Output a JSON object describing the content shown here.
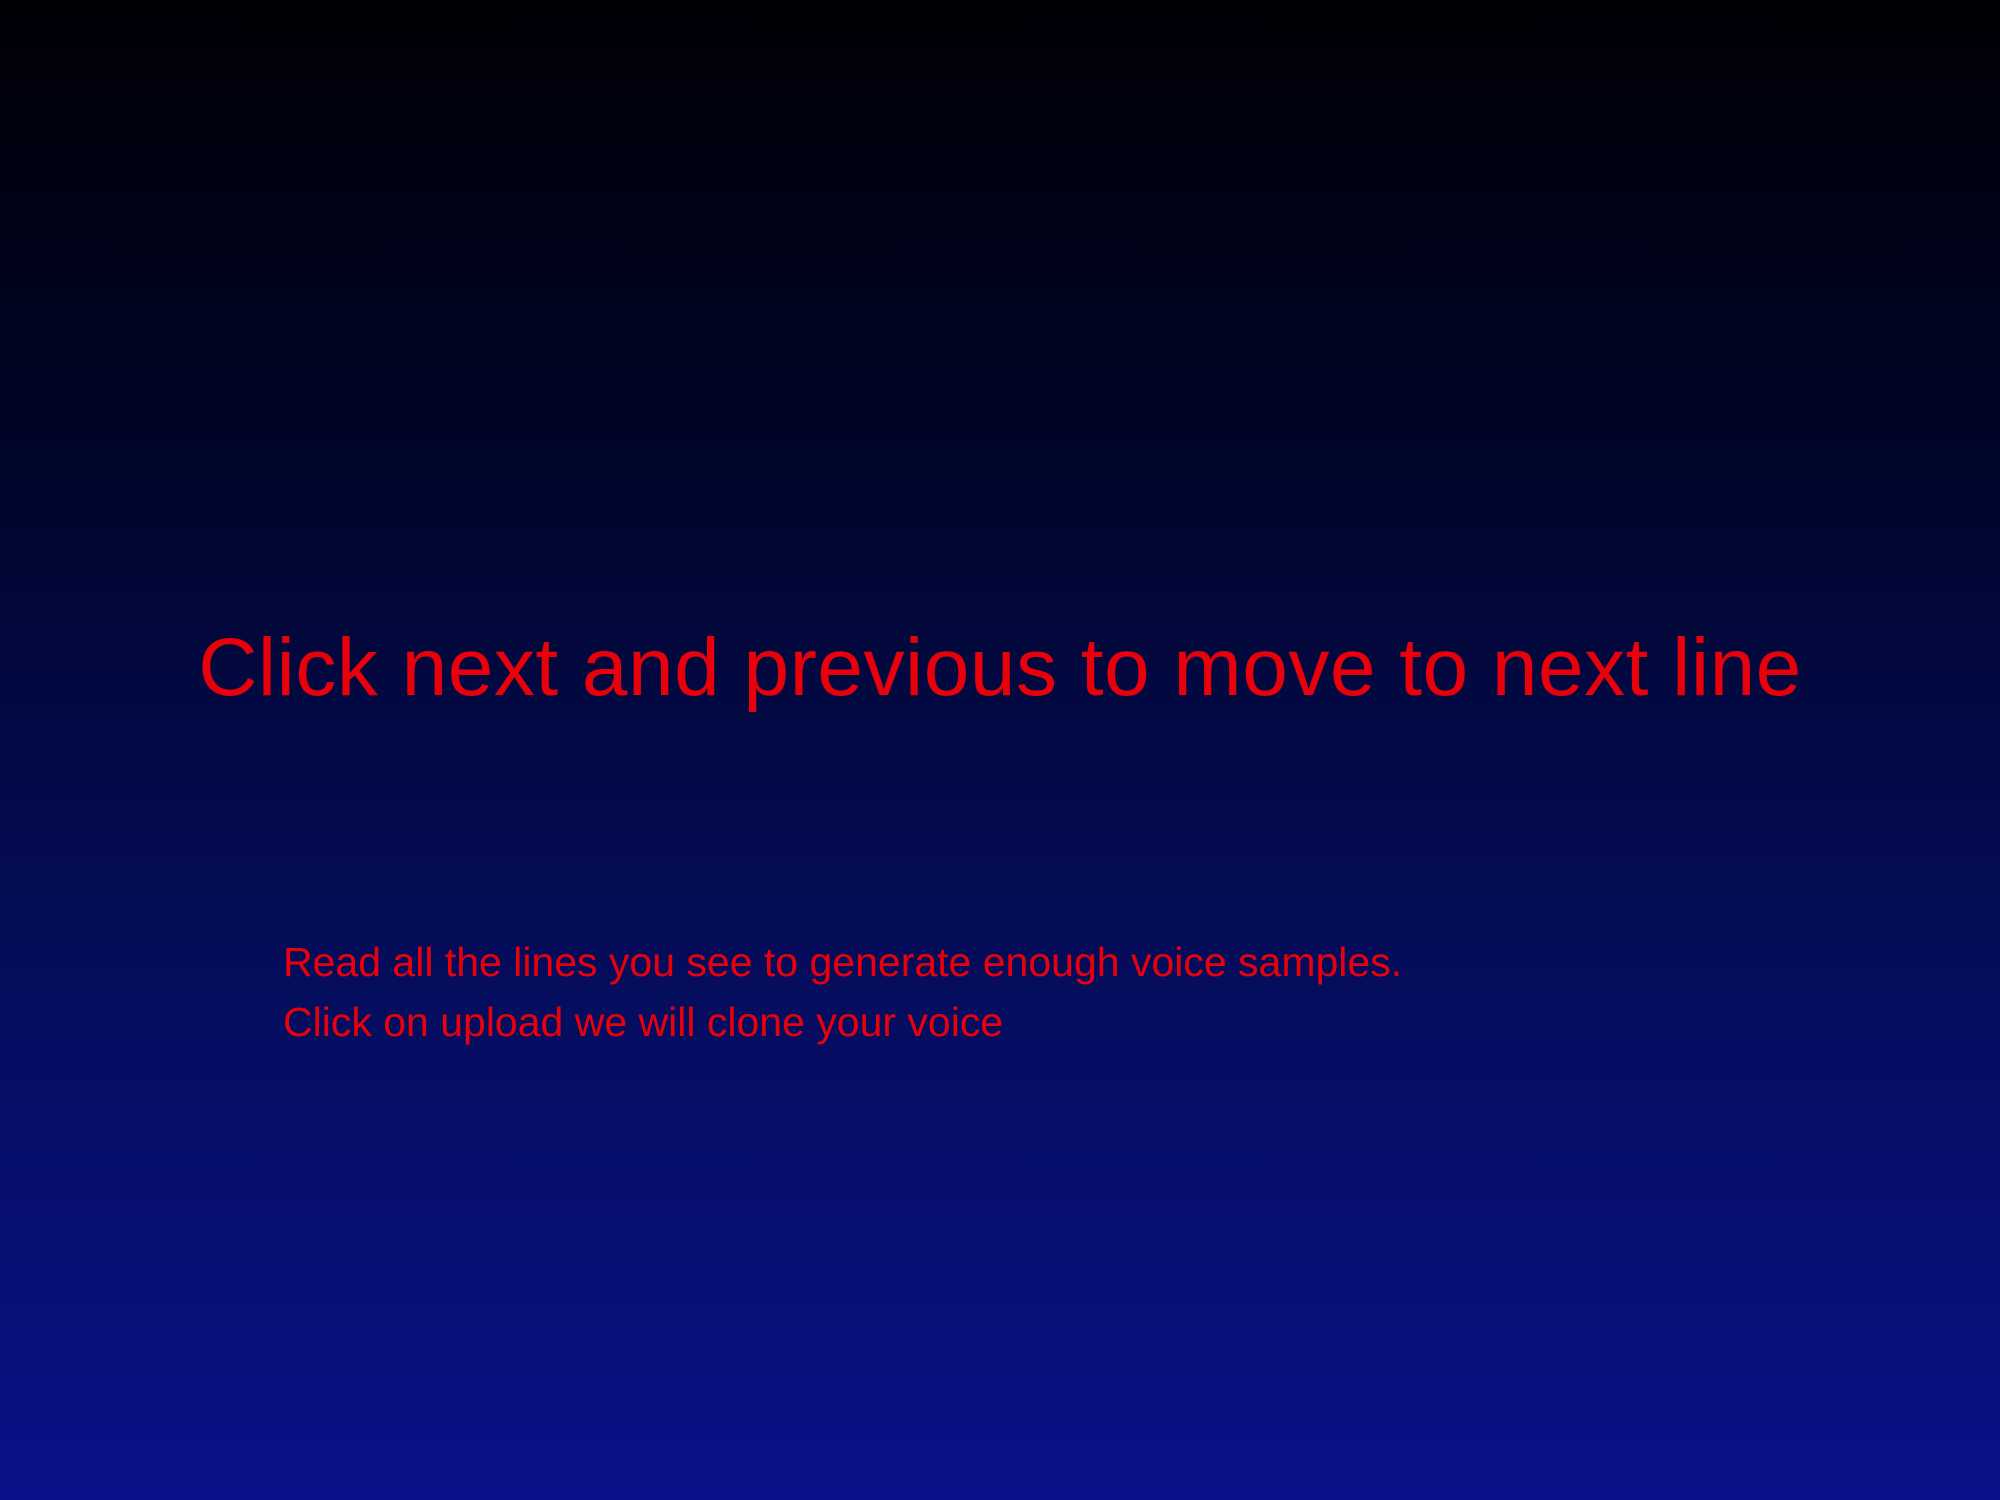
{
  "slide": {
    "title": "Click  next and previous to move to next line",
    "body_lines": [
      "Read all the lines you see to generate enough voice samples.",
      "Click on upload we will  clone your voice"
    ]
  },
  "colors": {
    "text": "#e8000b",
    "background_top": "#000005",
    "background_bottom": "#0a1189"
  }
}
